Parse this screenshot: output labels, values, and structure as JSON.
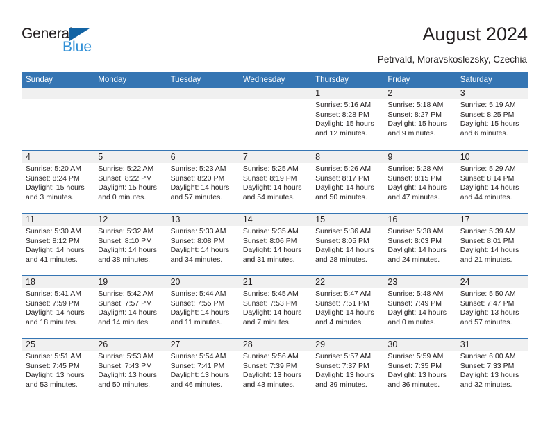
{
  "logo": {
    "primary_text": "General",
    "secondary_text": "Blue",
    "triangle_color": "#1263a4",
    "secondary_color": "#2f8fd6"
  },
  "header": {
    "title": "August 2024",
    "subtitle": "Petrvald, Moravskoslezsky, Czechia"
  },
  "theme": {
    "header_blue": "#3575b3",
    "band_gray": "#f0f0f0",
    "text": "#231f20"
  },
  "calendar": {
    "weekday_headers": [
      "Sunday",
      "Monday",
      "Tuesday",
      "Wednesday",
      "Thursday",
      "Friday",
      "Saturday"
    ],
    "weeks": [
      [
        {
          "day": "",
          "empty": true,
          "sunrise": "",
          "sunset": "",
          "daylight1": "",
          "daylight2": ""
        },
        {
          "day": "",
          "empty": true,
          "sunrise": "",
          "sunset": "",
          "daylight1": "",
          "daylight2": ""
        },
        {
          "day": "",
          "empty": true,
          "sunrise": "",
          "sunset": "",
          "daylight1": "",
          "daylight2": ""
        },
        {
          "day": "",
          "empty": true,
          "sunrise": "",
          "sunset": "",
          "daylight1": "",
          "daylight2": ""
        },
        {
          "day": "1",
          "empty": false,
          "sunrise": "Sunrise: 5:16 AM",
          "sunset": "Sunset: 8:28 PM",
          "daylight1": "Daylight: 15 hours",
          "daylight2": "and 12 minutes."
        },
        {
          "day": "2",
          "empty": false,
          "sunrise": "Sunrise: 5:18 AM",
          "sunset": "Sunset: 8:27 PM",
          "daylight1": "Daylight: 15 hours",
          "daylight2": "and 9 minutes."
        },
        {
          "day": "3",
          "empty": false,
          "sunrise": "Sunrise: 5:19 AM",
          "sunset": "Sunset: 8:25 PM",
          "daylight1": "Daylight: 15 hours",
          "daylight2": "and 6 minutes."
        }
      ],
      [
        {
          "day": "4",
          "empty": false,
          "sunrise": "Sunrise: 5:20 AM",
          "sunset": "Sunset: 8:24 PM",
          "daylight1": "Daylight: 15 hours",
          "daylight2": "and 3 minutes."
        },
        {
          "day": "5",
          "empty": false,
          "sunrise": "Sunrise: 5:22 AM",
          "sunset": "Sunset: 8:22 PM",
          "daylight1": "Daylight: 15 hours",
          "daylight2": "and 0 minutes."
        },
        {
          "day": "6",
          "empty": false,
          "sunrise": "Sunrise: 5:23 AM",
          "sunset": "Sunset: 8:20 PM",
          "daylight1": "Daylight: 14 hours",
          "daylight2": "and 57 minutes."
        },
        {
          "day": "7",
          "empty": false,
          "sunrise": "Sunrise: 5:25 AM",
          "sunset": "Sunset: 8:19 PM",
          "daylight1": "Daylight: 14 hours",
          "daylight2": "and 54 minutes."
        },
        {
          "day": "8",
          "empty": false,
          "sunrise": "Sunrise: 5:26 AM",
          "sunset": "Sunset: 8:17 PM",
          "daylight1": "Daylight: 14 hours",
          "daylight2": "and 50 minutes."
        },
        {
          "day": "9",
          "empty": false,
          "sunrise": "Sunrise: 5:28 AM",
          "sunset": "Sunset: 8:15 PM",
          "daylight1": "Daylight: 14 hours",
          "daylight2": "and 47 minutes."
        },
        {
          "day": "10",
          "empty": false,
          "sunrise": "Sunrise: 5:29 AM",
          "sunset": "Sunset: 8:14 PM",
          "daylight1": "Daylight: 14 hours",
          "daylight2": "and 44 minutes."
        }
      ],
      [
        {
          "day": "11",
          "empty": false,
          "sunrise": "Sunrise: 5:30 AM",
          "sunset": "Sunset: 8:12 PM",
          "daylight1": "Daylight: 14 hours",
          "daylight2": "and 41 minutes."
        },
        {
          "day": "12",
          "empty": false,
          "sunrise": "Sunrise: 5:32 AM",
          "sunset": "Sunset: 8:10 PM",
          "daylight1": "Daylight: 14 hours",
          "daylight2": "and 38 minutes."
        },
        {
          "day": "13",
          "empty": false,
          "sunrise": "Sunrise: 5:33 AM",
          "sunset": "Sunset: 8:08 PM",
          "daylight1": "Daylight: 14 hours",
          "daylight2": "and 34 minutes."
        },
        {
          "day": "14",
          "empty": false,
          "sunrise": "Sunrise: 5:35 AM",
          "sunset": "Sunset: 8:06 PM",
          "daylight1": "Daylight: 14 hours",
          "daylight2": "and 31 minutes."
        },
        {
          "day": "15",
          "empty": false,
          "sunrise": "Sunrise: 5:36 AM",
          "sunset": "Sunset: 8:05 PM",
          "daylight1": "Daylight: 14 hours",
          "daylight2": "and 28 minutes."
        },
        {
          "day": "16",
          "empty": false,
          "sunrise": "Sunrise: 5:38 AM",
          "sunset": "Sunset: 8:03 PM",
          "daylight1": "Daylight: 14 hours",
          "daylight2": "and 24 minutes."
        },
        {
          "day": "17",
          "empty": false,
          "sunrise": "Sunrise: 5:39 AM",
          "sunset": "Sunset: 8:01 PM",
          "daylight1": "Daylight: 14 hours",
          "daylight2": "and 21 minutes."
        }
      ],
      [
        {
          "day": "18",
          "empty": false,
          "sunrise": "Sunrise: 5:41 AM",
          "sunset": "Sunset: 7:59 PM",
          "daylight1": "Daylight: 14 hours",
          "daylight2": "and 18 minutes."
        },
        {
          "day": "19",
          "empty": false,
          "sunrise": "Sunrise: 5:42 AM",
          "sunset": "Sunset: 7:57 PM",
          "daylight1": "Daylight: 14 hours",
          "daylight2": "and 14 minutes."
        },
        {
          "day": "20",
          "empty": false,
          "sunrise": "Sunrise: 5:44 AM",
          "sunset": "Sunset: 7:55 PM",
          "daylight1": "Daylight: 14 hours",
          "daylight2": "and 11 minutes."
        },
        {
          "day": "21",
          "empty": false,
          "sunrise": "Sunrise: 5:45 AM",
          "sunset": "Sunset: 7:53 PM",
          "daylight1": "Daylight: 14 hours",
          "daylight2": "and 7 minutes."
        },
        {
          "day": "22",
          "empty": false,
          "sunrise": "Sunrise: 5:47 AM",
          "sunset": "Sunset: 7:51 PM",
          "daylight1": "Daylight: 14 hours",
          "daylight2": "and 4 minutes."
        },
        {
          "day": "23",
          "empty": false,
          "sunrise": "Sunrise: 5:48 AM",
          "sunset": "Sunset: 7:49 PM",
          "daylight1": "Daylight: 14 hours",
          "daylight2": "and 0 minutes."
        },
        {
          "day": "24",
          "empty": false,
          "sunrise": "Sunrise: 5:50 AM",
          "sunset": "Sunset: 7:47 PM",
          "daylight1": "Daylight: 13 hours",
          "daylight2": "and 57 minutes."
        }
      ],
      [
        {
          "day": "25",
          "empty": false,
          "sunrise": "Sunrise: 5:51 AM",
          "sunset": "Sunset: 7:45 PM",
          "daylight1": "Daylight: 13 hours",
          "daylight2": "and 53 minutes."
        },
        {
          "day": "26",
          "empty": false,
          "sunrise": "Sunrise: 5:53 AM",
          "sunset": "Sunset: 7:43 PM",
          "daylight1": "Daylight: 13 hours",
          "daylight2": "and 50 minutes."
        },
        {
          "day": "27",
          "empty": false,
          "sunrise": "Sunrise: 5:54 AM",
          "sunset": "Sunset: 7:41 PM",
          "daylight1": "Daylight: 13 hours",
          "daylight2": "and 46 minutes."
        },
        {
          "day": "28",
          "empty": false,
          "sunrise": "Sunrise: 5:56 AM",
          "sunset": "Sunset: 7:39 PM",
          "daylight1": "Daylight: 13 hours",
          "daylight2": "and 43 minutes."
        },
        {
          "day": "29",
          "empty": false,
          "sunrise": "Sunrise: 5:57 AM",
          "sunset": "Sunset: 7:37 PM",
          "daylight1": "Daylight: 13 hours",
          "daylight2": "and 39 minutes."
        },
        {
          "day": "30",
          "empty": false,
          "sunrise": "Sunrise: 5:59 AM",
          "sunset": "Sunset: 7:35 PM",
          "daylight1": "Daylight: 13 hours",
          "daylight2": "and 36 minutes."
        },
        {
          "day": "31",
          "empty": false,
          "sunrise": "Sunrise: 6:00 AM",
          "sunset": "Sunset: 7:33 PM",
          "daylight1": "Daylight: 13 hours",
          "daylight2": "and 32 minutes."
        }
      ]
    ]
  }
}
